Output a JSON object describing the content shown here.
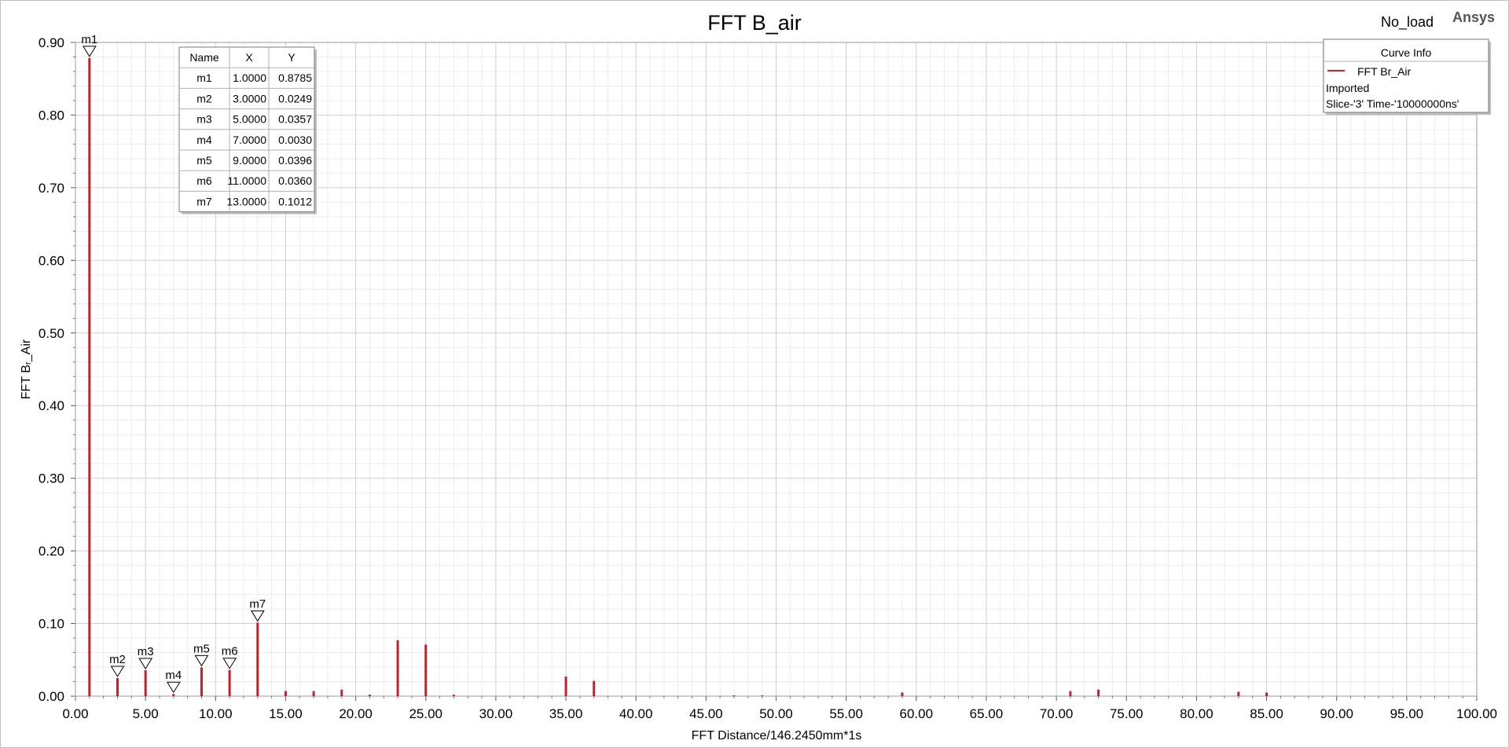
{
  "header": {
    "setup": "No_load",
    "brand": "Ansys"
  },
  "chart_data": {
    "type": "bar",
    "title": "FFT B_air",
    "xlabel": "FFT Distance/146.2450mm*1s",
    "ylabel": "FFT Bᵣ_Air",
    "xlim": [
      0,
      100
    ],
    "ylim": [
      0,
      0.9
    ],
    "xticks": [
      "0.00",
      "5.00",
      "10.00",
      "15.00",
      "20.00",
      "25.00",
      "30.00",
      "35.00",
      "40.00",
      "45.00",
      "50.00",
      "55.00",
      "60.00",
      "65.00",
      "70.00",
      "75.00",
      "80.00",
      "85.00",
      "90.00",
      "95.00",
      "100.00"
    ],
    "yticks": [
      "0.00",
      "0.10",
      "0.20",
      "0.30",
      "0.40",
      "0.50",
      "0.60",
      "0.70",
      "0.80",
      "0.90"
    ],
    "grid": true,
    "series": [
      {
        "name": "FFT Br_Air",
        "color": "#c0222b",
        "x": [
          1,
          3,
          5,
          7,
          9,
          11,
          13,
          15,
          17,
          19,
          21,
          23,
          25,
          27,
          35,
          37,
          47,
          49,
          59,
          71,
          73,
          83,
          85
        ],
        "values": [
          0.8785,
          0.0249,
          0.0357,
          0.003,
          0.0396,
          0.036,
          0.1012,
          0.007,
          0.007,
          0.009,
          0.002,
          0.077,
          0.071,
          0.002,
          0.027,
          0.021,
          0.001,
          0.001,
          0.005,
          0.007,
          0.009,
          0.006,
          0.005
        ]
      }
    ],
    "markers": [
      {
        "name": "m1",
        "x": 1,
        "y": 0.8785,
        "x_text": "1.0000",
        "y_text": "0.8785"
      },
      {
        "name": "m2",
        "x": 3,
        "y": 0.0249,
        "x_text": "3.0000",
        "y_text": "0.0249"
      },
      {
        "name": "m3",
        "x": 5,
        "y": 0.0357,
        "x_text": "5.0000",
        "y_text": "0.0357"
      },
      {
        "name": "m4",
        "x": 7,
        "y": 0.003,
        "x_text": "7.0000",
        "y_text": "0.0030"
      },
      {
        "name": "m5",
        "x": 9,
        "y": 0.0396,
        "x_text": "9.0000",
        "y_text": "0.0396"
      },
      {
        "name": "m6",
        "x": 11,
        "y": 0.036,
        "x_text": "11.0000",
        "y_text": "0.0360"
      },
      {
        "name": "m7",
        "x": 13,
        "y": 0.1012,
        "x_text": "13.0000",
        "y_text": "0.1012"
      }
    ],
    "marker_table": {
      "headers": [
        "Name",
        "X",
        "Y"
      ]
    },
    "legend": {
      "title": "Curve Info",
      "position": "top-right",
      "lines": [
        "FFT Br_Air",
        "Imported",
        "Slice-'3' Time-'10000000ns'"
      ]
    }
  }
}
